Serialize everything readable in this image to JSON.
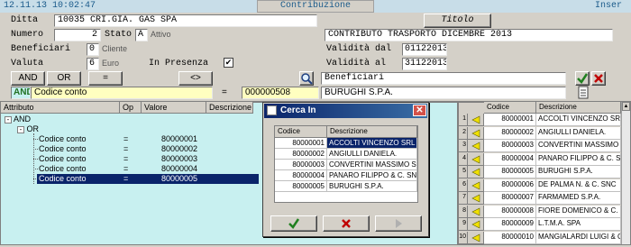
{
  "topbar": {
    "datetime": "12.11.13 10:02:47",
    "title": "Contribuzione",
    "mode": "Inser"
  },
  "form": {
    "ditta_label": "Ditta",
    "ditta_code": "10035",
    "ditta_name": "CRI.GIA. GAS SPA",
    "titolo_button": "Titolo",
    "numero_label": "Numero",
    "numero_value": "2",
    "stato_label": "Stato",
    "stato_value": "A",
    "stato_text": "Attivo",
    "contract_desc": "CONTRIBUTO TRASPORTO DICEMBRE 2013",
    "beneficiari_label": "Beneficiari",
    "beneficiari_value": "0",
    "beneficiari_text": "Cliente",
    "validita_dal_label": "Validità dal",
    "validita_dal_value": "01122013",
    "valuta_label": "Valuta",
    "valuta_value": "6",
    "valuta_text": "Euro",
    "in_presenza_label": "In Presenza",
    "in_presenza_check": "✔",
    "validita_al_label": "Validità  al",
    "validita_al_value": "31122013"
  },
  "filterbar": {
    "and_button": "AND",
    "or_button": "OR",
    "eq_button": "=",
    "neq_button": "<>",
    "beneficiari_field": "Beneficiari",
    "row_op": "AND",
    "row_attr": "Codice conto",
    "row_eq": "=",
    "row_value": "000000508",
    "row_desc": "BURUGHI S.P.A."
  },
  "tree": {
    "columns": [
      "Attributo",
      "Op",
      "Valore",
      "Descrizione"
    ],
    "root": "AND",
    "child": "OR",
    "rows": [
      {
        "attr": "Codice conto",
        "op": "=",
        "value": "80000001"
      },
      {
        "attr": "Codice conto",
        "op": "=",
        "value": "80000002"
      },
      {
        "attr": "Codice conto",
        "op": "=",
        "value": "80000003"
      },
      {
        "attr": "Codice conto",
        "op": "=",
        "value": "80000004"
      },
      {
        "attr": "Codice conto",
        "op": "=",
        "value": "80000005"
      }
    ]
  },
  "dialog": {
    "title": "Cerca In",
    "columns": [
      "Codice",
      "Descrizione"
    ],
    "rows": [
      {
        "code": "80000001",
        "desc": "ACCOLTI VINCENZO SRL"
      },
      {
        "code": "80000002",
        "desc": "ANGIULLI DANIELA."
      },
      {
        "code": "80000003",
        "desc": "CONVERTINI MASSIMO SRL"
      },
      {
        "code": "80000004",
        "desc": "PANARO FILIPPO & C. SNC"
      },
      {
        "code": "80000005",
        "desc": "BURUGHI S.P.A."
      }
    ],
    "selected_index": 0
  },
  "rightgrid": {
    "columns": [
      "Codice",
      "Descrizione"
    ],
    "rows": [
      {
        "n": "1",
        "code": "80000001",
        "desc": "ACCOLTI VINCENZO SRL"
      },
      {
        "n": "2",
        "code": "80000002",
        "desc": "ANGIULLI DANIELA."
      },
      {
        "n": "3",
        "code": "80000003",
        "desc": "CONVERTINI MASSIMO SRL"
      },
      {
        "n": "4",
        "code": "80000004",
        "desc": "PANARO FILIPPO & C. SNC"
      },
      {
        "n": "5",
        "code": "80000005",
        "desc": "BURUGHI S.P.A."
      },
      {
        "n": "6",
        "code": "80000006",
        "desc": "DE PALMA N. & C. SNC"
      },
      {
        "n": "7",
        "code": "80000007",
        "desc": "FARMAMED S.P.A."
      },
      {
        "n": "8",
        "code": "80000008",
        "desc": "FIORE DOMENICO & C. SNC"
      },
      {
        "n": "9",
        "code": "80000009",
        "desc": "L.T.M.A. SPA"
      },
      {
        "n": "10",
        "code": "80000010",
        "desc": "MANGIALARDI LUIGI & C.SA"
      }
    ]
  },
  "colors": {
    "accent": "#1a5a8a",
    "selection": "#0a246a",
    "tree_bg": "#c8f0f0",
    "yellow_field": "#ffffc0"
  }
}
